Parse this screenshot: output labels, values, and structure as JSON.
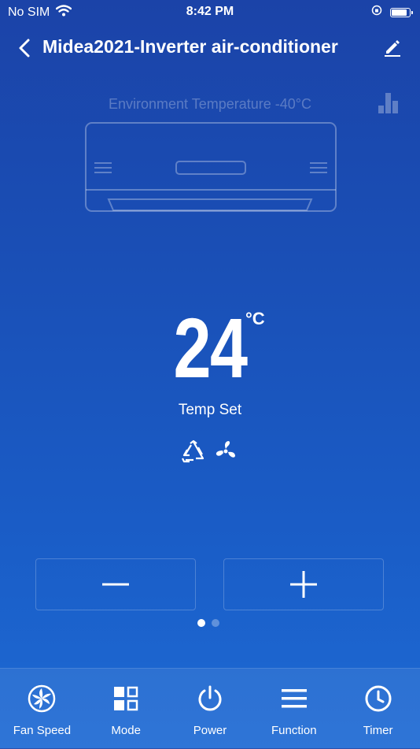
{
  "status_bar": {
    "carrier": "No SIM",
    "time": "8:42 PM"
  },
  "header": {
    "title": "Midea2021-Inverter air-conditioner"
  },
  "environment": {
    "label": "Environment Temperature -40°C"
  },
  "temperature": {
    "value": "24",
    "unit": "°C",
    "label": "Temp Set"
  },
  "mode_icons": [
    "recycle-icon",
    "fan-icon"
  ],
  "controls": {
    "decrease_icon": "minus-icon",
    "increase_icon": "plus-icon"
  },
  "pagination": {
    "total": 2,
    "current": 1
  },
  "bottom_nav": [
    {
      "label": "Fan Speed",
      "icon": "fan-icon"
    },
    {
      "label": "Mode",
      "icon": "mode-icon"
    },
    {
      "label": "Power",
      "icon": "power-icon"
    },
    {
      "label": "Function",
      "icon": "menu-icon"
    },
    {
      "label": "Timer",
      "icon": "clock-icon"
    }
  ],
  "colors": {
    "background_top": "#1b43a8",
    "background_bottom": "#1d6ad4",
    "foreground": "#ffffff"
  }
}
